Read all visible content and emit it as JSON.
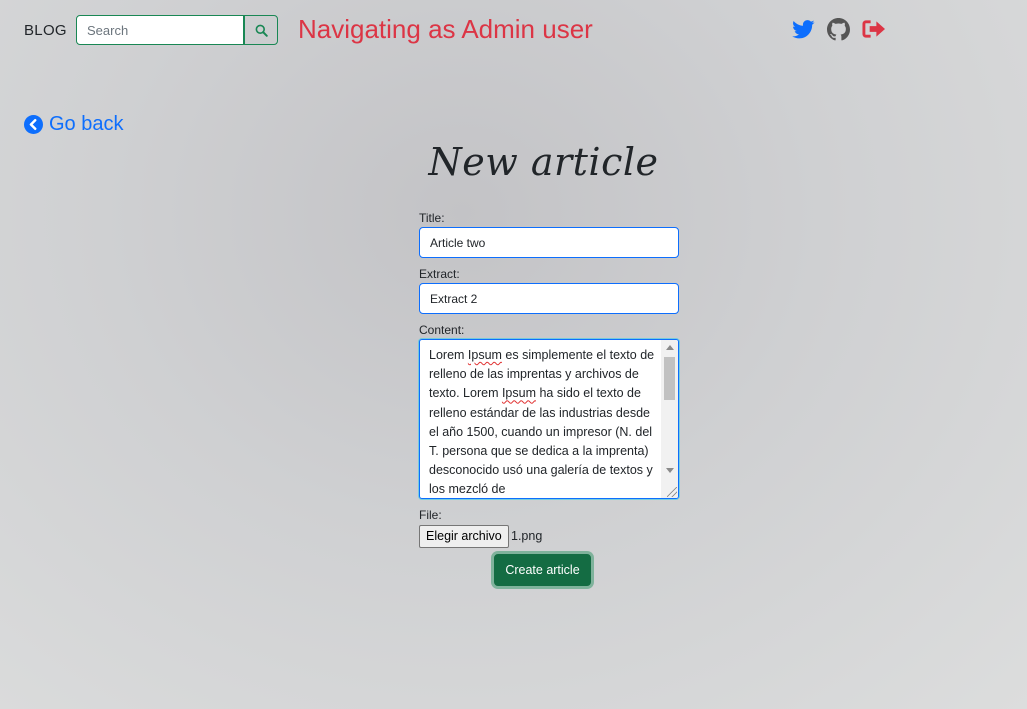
{
  "navbar": {
    "brand": "BLOG",
    "search_placeholder": "Search",
    "search_value": "",
    "status_text": "Navigating as Admin user",
    "icons": [
      "search-icon",
      "twitter-icon",
      "github-icon",
      "logout-icon"
    ]
  },
  "go_back": {
    "label": "Go back",
    "icon": "chevron-left-circle-icon"
  },
  "page": {
    "title": "New article"
  },
  "form": {
    "title_label": "Title:",
    "title_value": "Article two",
    "extract_label": "Extract:",
    "extract_value": "Extract 2",
    "content_label": "Content:",
    "content_value": "Lorem Ipsum es simplemente el texto de relleno de las imprentas y archivos de texto. Lorem Ipsum ha sido el texto de relleno estándar de las industrias desde el año 1500, cuando un impresor (N. del T. persona que se dedica a la imprenta) desconocido usó una galería de textos y los mezcló de",
    "file_label": "File:",
    "file_button": "Elegir archivo",
    "file_name": "1.png",
    "submit_label": "Create article"
  },
  "colors": {
    "status_red": "#dc3545",
    "link_blue": "#0d6efd",
    "button_green": "#146c43",
    "twitter_blue": "#0d6efd",
    "github_gray": "#555555"
  }
}
